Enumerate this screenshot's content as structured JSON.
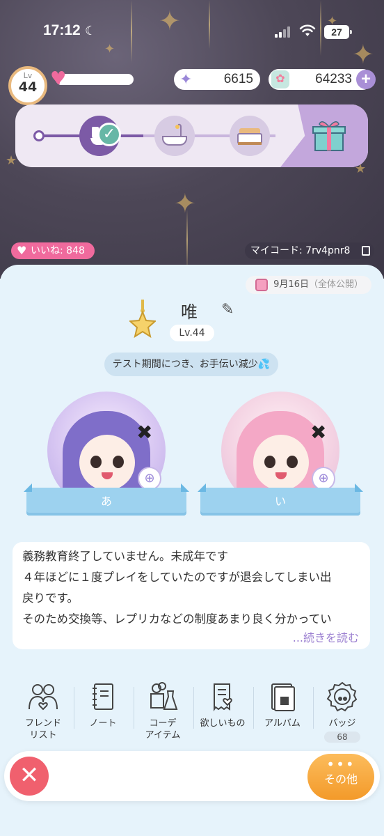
{
  "status_bar": {
    "time": "17:12",
    "battery": "27"
  },
  "player": {
    "level_small": "Lv",
    "level_num": "44",
    "heart_fill": 0.05
  },
  "currency": {
    "stars": "6615",
    "coins": "64233"
  },
  "likes": {
    "label": "いいね: 848"
  },
  "my_code": {
    "label": "マイコード: 7rv4pnr8"
  },
  "profile": {
    "date": "9月16日",
    "visibility": "（全体公開）",
    "name": "唯",
    "level": "Lv.44",
    "status_message": "テスト期間につき、お手伝い減少💦",
    "avatars": [
      {
        "label": "あ"
      },
      {
        "label": "い"
      }
    ],
    "bio_lines": [
      "義務教育終了していません。未成年です",
      "４年ほどに１度プレイをしていたのですが退会してしまい出",
      "戻りです。",
      "そのため交換等、レプリカなどの制度あまり良く分かってい"
    ],
    "read_more": "...続きを読む"
  },
  "menu": [
    {
      "label": "フレンド\nリスト",
      "icon": "friends-icon"
    },
    {
      "label": "ノート",
      "icon": "notebook-icon"
    },
    {
      "label": "コーデ\nアイテム",
      "icon": "outfit-icon"
    },
    {
      "label": "欲しいもの",
      "icon": "wishlist-icon"
    },
    {
      "label": "アルバム",
      "icon": "album-icon"
    },
    {
      "label": "バッジ",
      "icon": "badge-icon",
      "count": "68"
    }
  ],
  "bottom_bar": {
    "close_symbol": "✕",
    "other_dots": "•••",
    "other_label": "その他"
  },
  "colors": {
    "accent_purple": "#7c5aa6",
    "likes_pink": "#f06a9d",
    "card_bg": "#e6f3fb",
    "read_more": "#9a7ed0",
    "close_red": "#f0606e",
    "other_orange": "#f39a2a"
  }
}
